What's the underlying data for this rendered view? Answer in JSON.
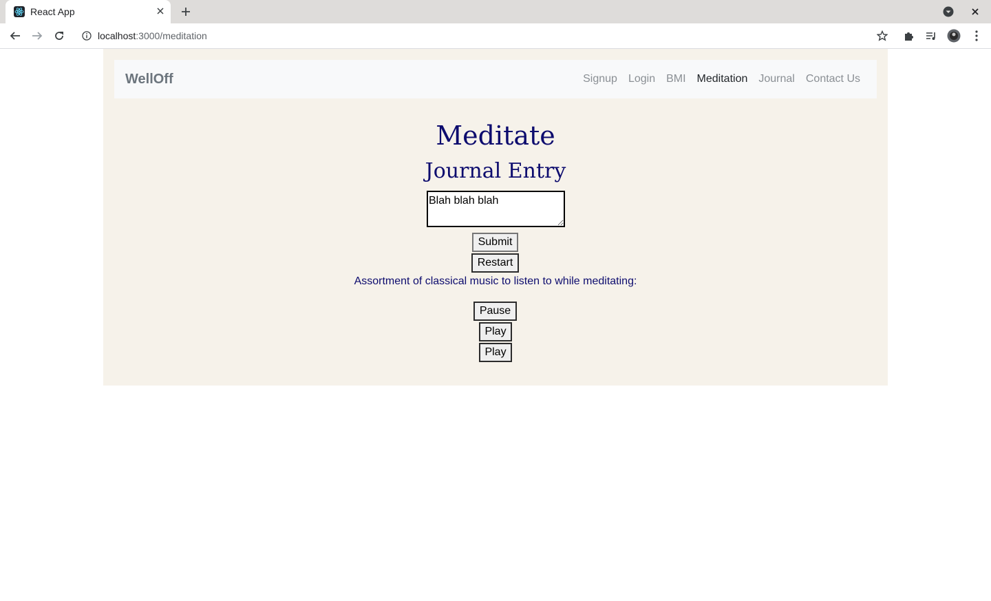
{
  "browser": {
    "tab_title": "React App",
    "url_host": "localhost",
    "url_path": ":3000/meditation",
    "icons": [
      "react-favicon",
      "close-icon",
      "plus-icon",
      "back-arrow-icon",
      "forward-arrow-icon",
      "reload-icon",
      "info-icon",
      "star-icon",
      "puzzle-icon",
      "media-icon",
      "profile-avatar",
      "kebab-menu-icon"
    ]
  },
  "navbar": {
    "brand": "WellOff",
    "links": [
      "Signup",
      "Login",
      "BMI",
      "Meditation",
      "Journal",
      "Contact Us"
    ],
    "active_link": "Meditation"
  },
  "main": {
    "title": "Meditate",
    "subtitle": "Journal Entry",
    "journal_value": "Blah blah blah",
    "submit_label": "Submit",
    "restart_label": "Restart",
    "music_text": "Assortment of classical music to listen to while meditating:",
    "pause_label": "Pause",
    "play_label_1": "Play",
    "play_label_2": "Play"
  },
  "colors": {
    "page_bg": "#f6f2ea",
    "navbar_bg": "#f8f9fa",
    "heading": "#0d0c6e"
  }
}
